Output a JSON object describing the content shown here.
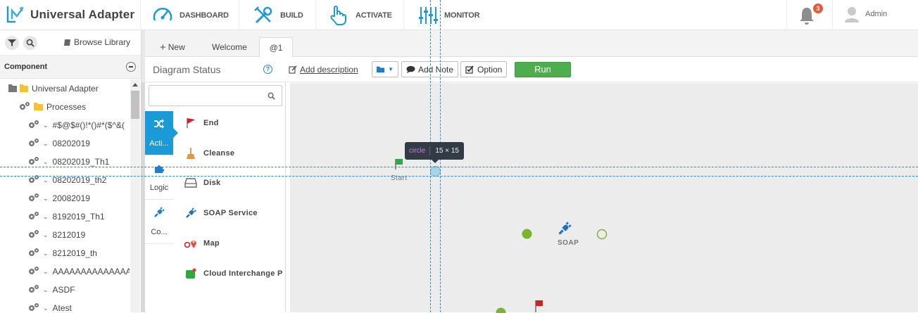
{
  "app": {
    "title": "Universal Adapter",
    "brand_color": "#1a9ad6"
  },
  "nav": {
    "items": [
      {
        "label": "DASHBOARD",
        "icon": "speedometer-icon"
      },
      {
        "label": "BUILD",
        "icon": "tools-icon"
      },
      {
        "label": "ACTIVATE",
        "icon": "hand-pointer-icon"
      },
      {
        "label": "MONITOR",
        "icon": "sliders-icon"
      }
    ],
    "notifications": "3",
    "user": "Admin"
  },
  "left_panel": {
    "browse_label": "Browse Library",
    "component_title": "Component",
    "tree": [
      {
        "label": "Universal Adapter",
        "level": 0,
        "kind": "folder"
      },
      {
        "label": "Processes",
        "level": 1,
        "kind": "folder"
      },
      {
        "label": "#$@$#()!*()#*($^&(",
        "level": 2,
        "kind": "process"
      },
      {
        "label": "08202019",
        "level": 2,
        "kind": "process"
      },
      {
        "label": "08202019_Th1",
        "level": 2,
        "kind": "process"
      },
      {
        "label": "08202019_th2",
        "level": 2,
        "kind": "process"
      },
      {
        "label": "20082019",
        "level": 2,
        "kind": "process"
      },
      {
        "label": "8192019_Th1",
        "level": 2,
        "kind": "process"
      },
      {
        "label": "8212019",
        "level": 2,
        "kind": "process"
      },
      {
        "label": "8212019_th",
        "level": 2,
        "kind": "process"
      },
      {
        "label": "AAAAAAAAAAAAAAAAAA",
        "level": 2,
        "kind": "process"
      },
      {
        "label": "ASDF",
        "level": 2,
        "kind": "process"
      },
      {
        "label": "Atest",
        "level": 2,
        "kind": "process"
      }
    ]
  },
  "tabs": [
    {
      "label": "New"
    },
    {
      "label": "Welcome"
    },
    {
      "label": "@1",
      "active": true
    }
  ],
  "toolbar": {
    "diagram_status": "Diagram Status",
    "help": "?",
    "add_description": "Add description",
    "add_note": "Add Note",
    "option": "Option",
    "run": "Run"
  },
  "palette": {
    "search_placeholder": "",
    "categories": [
      {
        "label": "Acti...",
        "icon": "shuffle-icon",
        "active": true
      },
      {
        "label": "Logic",
        "icon": "puzzle-icon"
      },
      {
        "label": "Co...",
        "icon": "plug-icon"
      }
    ],
    "items": [
      {
        "label": "End",
        "icon": "flag-icon"
      },
      {
        "label": "Cleanse",
        "icon": "broom-icon"
      },
      {
        "label": "Disk",
        "icon": "disk-icon"
      },
      {
        "label": "SOAP Service",
        "icon": "plug-icon"
      },
      {
        "label": "Map",
        "icon": "map-pin-icon"
      },
      {
        "label": "Cloud Interchange P",
        "icon": "cloud-interchange-icon"
      }
    ]
  },
  "canvas": {
    "start_label": "Start",
    "soap_label": "SOAP",
    "colors": {
      "start": "#2eaa3c",
      "soap": "#1e6fc9",
      "dot": "#7cb32f",
      "end": "#d32020"
    }
  },
  "tooltip": {
    "element": "circle",
    "size": "15 × 15"
  }
}
